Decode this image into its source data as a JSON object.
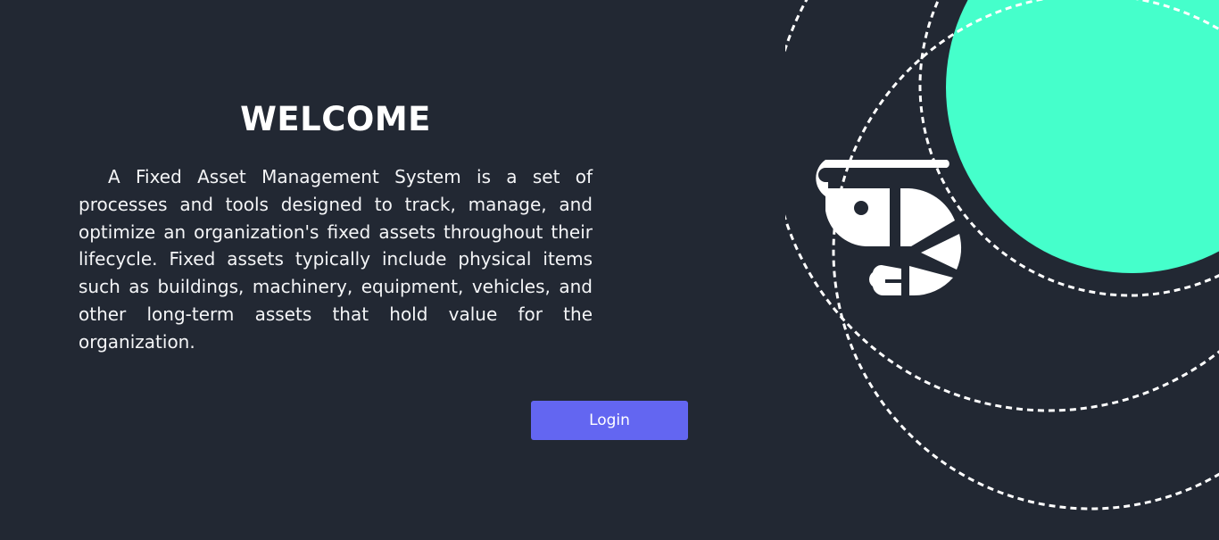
{
  "welcome": {
    "title": "WELCOME",
    "description": "A Fixed Asset Management System is a set of processes and tools designed to track, manage, and optimize an organization's fixed assets throughout their lifecycle. Fixed assets typically include physical items such as buildings, machinery, equipment, vehicles, and other long-term assets that hold value for the organization."
  },
  "actions": {
    "login_label": "Login"
  },
  "colors": {
    "background": "#222833",
    "accent_circle": "#45ffcb",
    "button": "#6366f1",
    "text": "#ffffff"
  },
  "icons": {
    "hero": "shrimp-icon"
  }
}
